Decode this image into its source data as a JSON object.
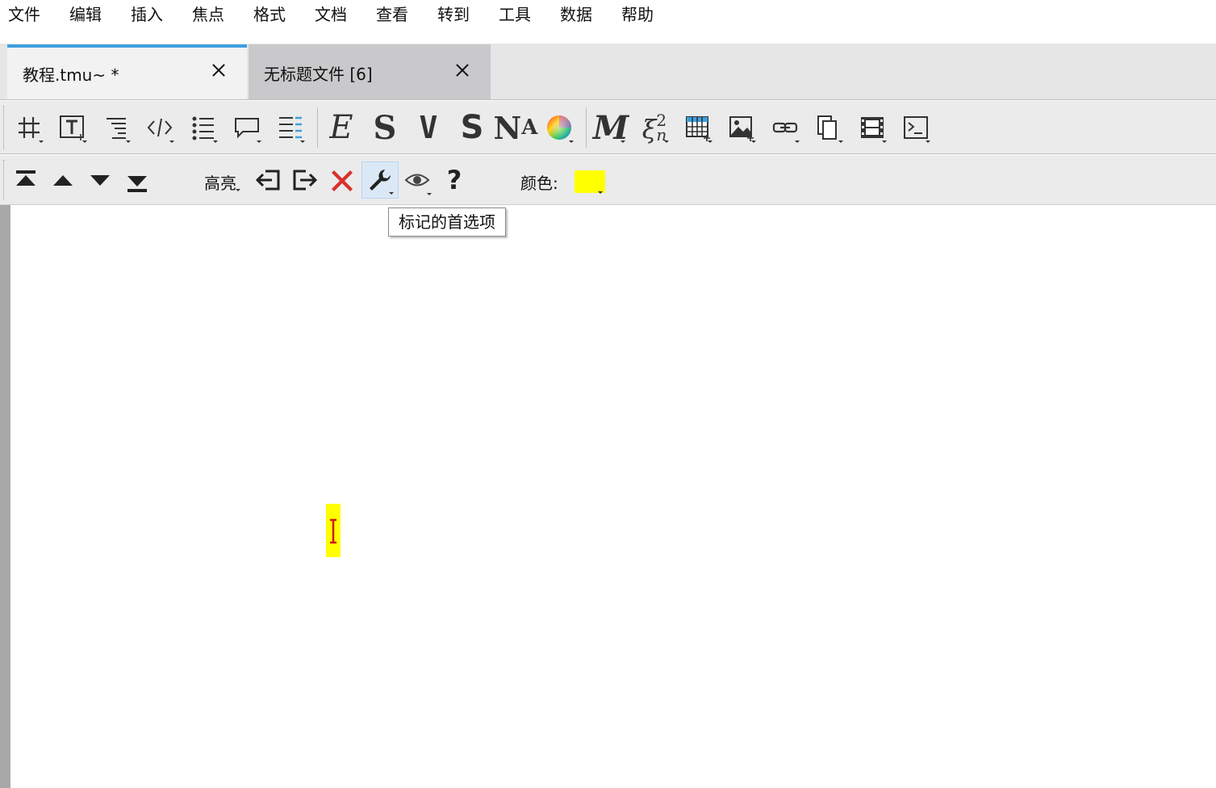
{
  "menu": [
    "文件",
    "编辑",
    "插入",
    "焦点",
    "格式",
    "文档",
    "查看",
    "转到",
    "工具",
    "数据",
    "帮助"
  ],
  "tabs": [
    {
      "label": "教程.tmu~ *",
      "active": true
    },
    {
      "label": "无标题文件 [6]",
      "active": false
    }
  ],
  "toolbar1": {
    "icons": [
      "section-icon",
      "text-style-icon",
      "paragraph-format-icon",
      "code-icon",
      "list-icon",
      "comment-bubble-icon",
      "table-of-contents-icon",
      "emphasis-icon",
      "strong-icon",
      "verbatim-icon",
      "sans-serif-icon",
      "small-caps-icon",
      "color-wheel-icon",
      "math-icon",
      "formula-icon",
      "insert-table-icon",
      "insert-image-icon",
      "link-icon",
      "copy-icon",
      "film-icon",
      "terminal-icon"
    ],
    "glyphs": {
      "emphasis": "E",
      "strong": "S",
      "verbatim": "V",
      "sans": "S",
      "smallcaps_n": "N",
      "smallcaps_a": "A",
      "math": "M",
      "formula": "ξ",
      "formula_sup": "2",
      "formula_sub": "n"
    }
  },
  "toolbar2": {
    "highlight_label": "高亮",
    "color_label": "颜色:",
    "color_value": "#ffff00",
    "icons": [
      "first-mark-icon",
      "previous-mark-icon",
      "next-mark-icon",
      "last-mark-icon",
      "enter-mark-icon",
      "exit-mark-icon",
      "delete-mark-icon",
      "preferences-wrench-icon",
      "view-eye-icon",
      "help-icon"
    ],
    "help_glyph": "?"
  },
  "tooltip": "标记的首选项",
  "colors": {
    "accent": "#3d9fe0",
    "highlight": "#ffff00",
    "delete": "#d9302c",
    "cursor": "#d11a1a"
  }
}
